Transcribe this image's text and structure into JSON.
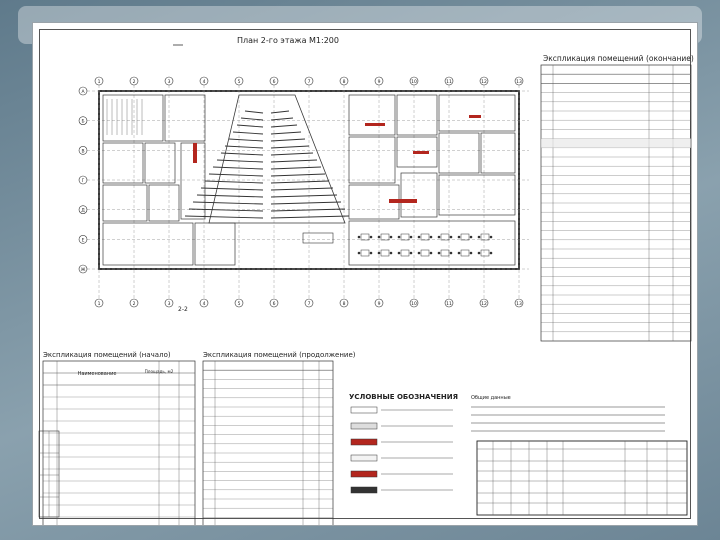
{
  "plan": {
    "title": "План 2-го этажа М1:200",
    "axes_letters": [
      "А",
      "Б",
      "В",
      "Г",
      "Д",
      "Е",
      "Ж"
    ],
    "axes_numbers": [
      "1",
      "2",
      "3",
      "4",
      "5",
      "6",
      "7",
      "8",
      "9",
      "10",
      "11",
      "12",
      "13"
    ],
    "section_mark": "2-2"
  },
  "explication_end": {
    "title": "Экспликация помещений (окончание)",
    "row_count": 30
  },
  "explication_start": {
    "title": "Экспликация помещений (начало)",
    "header_name": "Наименование",
    "header_area": "Площадь, м2",
    "row_count": 14
  },
  "explication_cont": {
    "title": "Экспликация помещений (продолжение)",
    "row_count": 18
  },
  "legend": {
    "title": "УСЛОВНЫЕ ОБОЗНАЧЕНИЯ",
    "items_count": 6
  },
  "notes": {
    "heading": "Общие данные",
    "lines_count": 4
  },
  "stamp": {
    "code": "",
    "sheet": ""
  },
  "colors": {
    "slide_bg": "#6f8796",
    "line": "#3a3a3a",
    "hatch_red": "#b3261e",
    "paper": "#ffffff"
  }
}
